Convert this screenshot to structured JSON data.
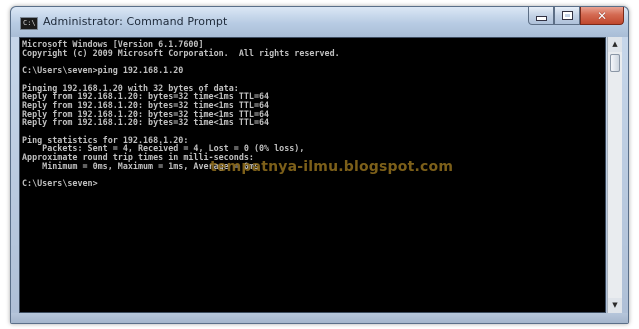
{
  "window": {
    "title": "Administrator: Command Prompt",
    "icon_text": "C:\\",
    "buttons": {
      "minimize": "minimize-icon",
      "maximize": "maximize-icon",
      "close": "✕"
    }
  },
  "console": {
    "lines": [
      "Microsoft Windows [Version 6.1.7600]",
      "Copyright (c) 2009 Microsoft Corporation.  All rights reserved.",
      "",
      "C:\\Users\\seven>ping 192.168.1.20",
      "",
      "Pinging 192.168.1.20 with 32 bytes of data:",
      "Reply from 192.168.1.20: bytes=32 time<1ms TTL=64",
      "Reply from 192.168.1.20: bytes=32 time<1ms TTL=64",
      "Reply from 192.168.1.20: bytes=32 time<1ms TTL=64",
      "Reply from 192.168.1.20: bytes=32 time<1ms TTL=64",
      "",
      "Ping statistics for 192.168.1.20:",
      "    Packets: Sent = 4, Received = 4, Lost = 0 (0% loss),",
      "Approximate round trip times in milli-seconds:",
      "    Minimum = 0ms, Maximum = 1ms, Average = 0ms",
      "",
      "C:\\Users\\seven>"
    ],
    "text_color": "#c0c0c0",
    "background": "#000000"
  },
  "watermark": "tempatnya-ilmu.blogspot.com",
  "scrollbar": {
    "up_arrow": "▲",
    "down_arrow": "▼"
  }
}
